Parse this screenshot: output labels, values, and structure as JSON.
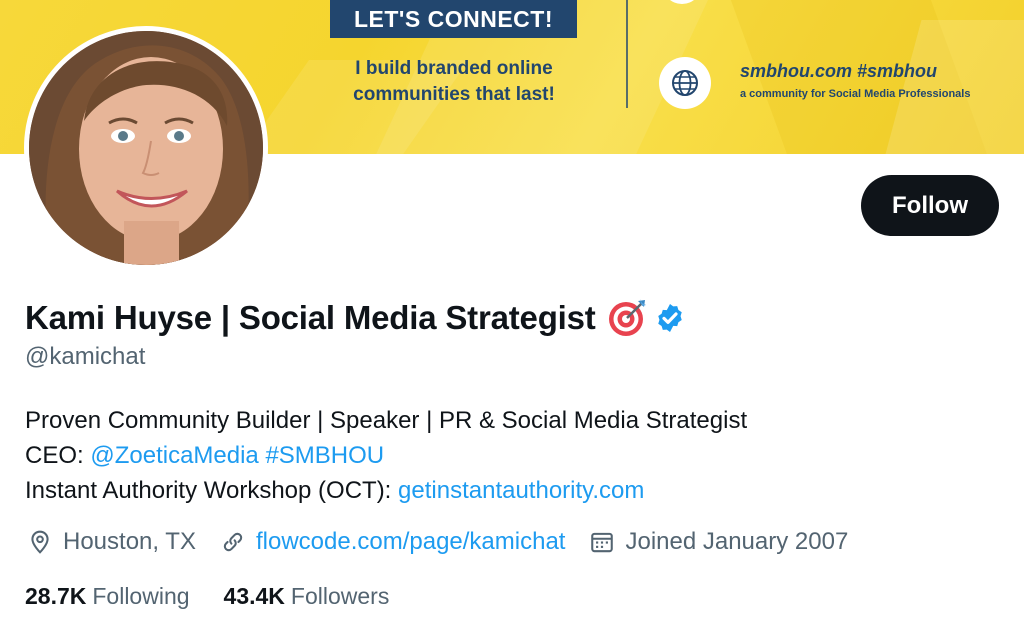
{
  "banner": {
    "connect_label": "LET'S CONNECT!",
    "tagline_line1": "I build branded online",
    "tagline_line2": "communities that last!",
    "site_name": "smbhou.com #smbhou",
    "site_sub": "a community for Social Media Professionals",
    "accent": "#22466e",
    "background": "#f5d52e"
  },
  "profile": {
    "display_name": "Kami Huyse | Social Media Strategist",
    "emoji_icon": "direct-hit-target-emoji",
    "verified_icon": "verified-badge-icon",
    "handle": "@kamichat",
    "follow_label": "Follow"
  },
  "bio": {
    "line1": "Proven Community Builder | Speaker | PR & Social Media Strategist",
    "line2_prefix": "CEO: ",
    "line2_mention": "@ZoeticaMedia",
    "line2_space": " ",
    "line2_hashtag": "#SMBHOU",
    "line3_prefix": "Instant Authority Workshop (OCT): ",
    "line3_link": "getinstantauthority.com"
  },
  "meta": {
    "location": "Houston, TX",
    "website": "flowcode.com/page/kamichat",
    "joined": "Joined January 2007"
  },
  "stats": {
    "following_count": "28.7K",
    "following_label": "Following",
    "followers_count": "43.4K",
    "followers_label": "Followers"
  },
  "colors": {
    "link": "#1d9bf0",
    "secondary_text": "#536471",
    "primary_text": "#0f1419",
    "verified": "#1d9bf0"
  }
}
